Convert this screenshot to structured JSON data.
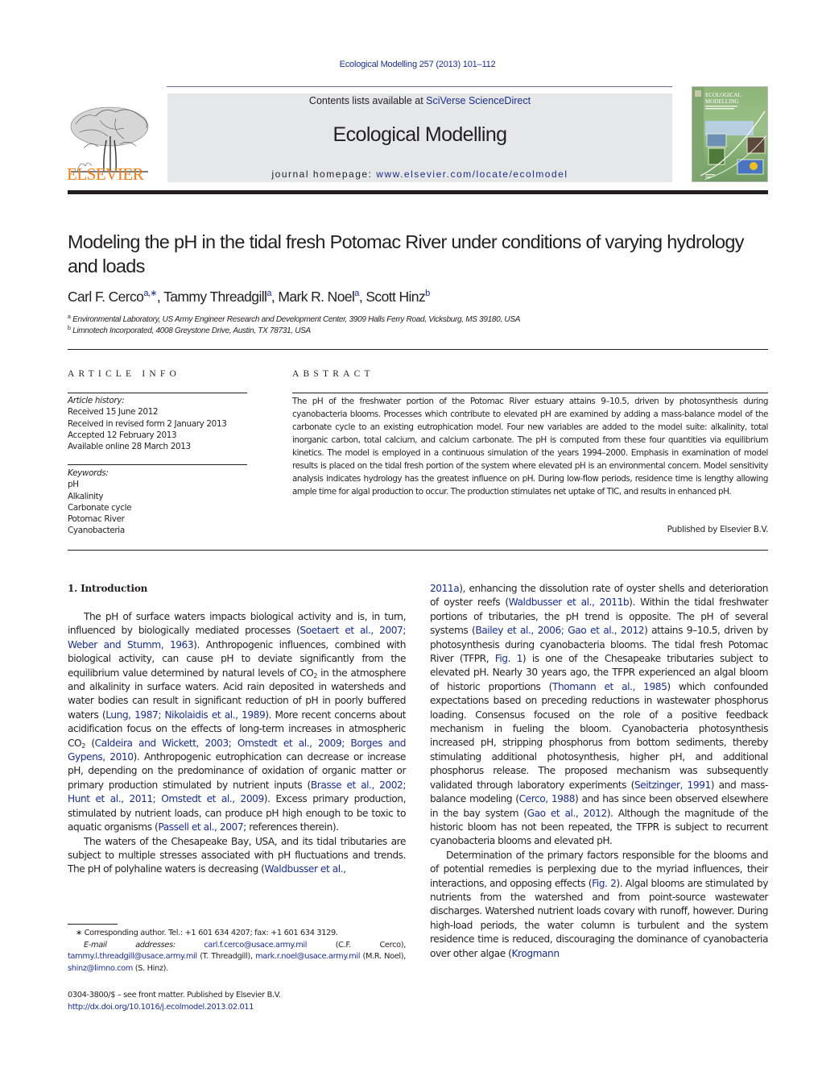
{
  "header": {
    "journal_ref": "Ecological Modelling 257 (2013) 101–112",
    "contents_prefix": "Contents lists available at ",
    "contents_link": "SciVerse ScienceDirect",
    "journal_name": "Ecological Modelling",
    "homepage_prefix": "journal homepage: ",
    "homepage_link": "www.elsevier.com/locate/ecolmodel",
    "publisher_logo": "ELSEVIER",
    "cover": {
      "line1": "ECOLOGICAL",
      "line2": "MODELLING"
    },
    "colors": {
      "link": "#1b2f8a",
      "elsevier_orange": "#f07d1a",
      "masthead_bg": "#e6e7e8"
    }
  },
  "article": {
    "title": "Modeling the pH in the tidal fresh Potomac River under conditions of varying hydrology and loads",
    "authors": [
      {
        "name": "Carl F. Cerco",
        "marks": "a,∗",
        "sep": ", "
      },
      {
        "name": "Tammy Threadgill",
        "marks": "a",
        "sep": ", "
      },
      {
        "name": "Mark R. Noel",
        "marks": "a",
        "sep": ", "
      },
      {
        "name": "Scott Hinz",
        "marks": "b",
        "sep": ""
      }
    ],
    "affiliations": [
      {
        "mark": "a",
        "text": "Environmental Laboratory, US Army Engineer Research and Development Center, 3909 Halls Ferry Road, Vicksburg, MS 39180, USA"
      },
      {
        "mark": "b",
        "text": "Limnotech Incorporated, 4008 Greystone Drive, Austin, TX 78731, USA"
      }
    ]
  },
  "article_info": {
    "heading": "ARTICLE INFO",
    "history_label": "Article history:",
    "history": [
      "Received 15 June 2012",
      "Received in revised form 2 January 2013",
      "Accepted 12 February 2013",
      "Available online 28 March 2013"
    ],
    "keywords_label": "Keywords:",
    "keywords": [
      "pH",
      "Alkalinity",
      "Carbonate cycle",
      "Potomac River",
      "Cyanobacteria"
    ]
  },
  "abstract": {
    "heading": "ABSTRACT",
    "text": "The pH of the freshwater portion of the Potomac River estuary attains 9–10.5, driven by photosynthesis during cyanobacteria blooms. Processes which contribute to elevated pH are examined by adding a mass-balance model of the carbonate cycle to an existing eutrophication model. Four new variables are added to the model suite: alkalinity, total inorganic carbon, total calcium, and calcium carbonate. The pH is computed from these four quantities via equilibrium kinetics. The model is employed in a continuous simulation of the years 1994–2000. Emphasis in examination of model results is placed on the tidal fresh portion of the system where elevated pH is an environmental concern. Model sensitivity analysis indicates hydrology has the greatest influence on pH. During low-flow periods, residence time is lengthy allowing ample time for algal production to occur. The production stimulates net uptake of TIC, and results in enhanced pH.",
    "published_by": "Published by Elsevier B.V."
  },
  "introduction": {
    "heading": "1.  Introduction",
    "left_column": [
      [
        {
          "t": "The pH of surface waters impacts biological activity and is, in turn, influenced by biologically mediated processes ("
        },
        {
          "t": "Soetaert et al., 2007; Weber and Stumm, 1963",
          "link": true
        },
        {
          "t": "). Anthropogenic influences, combined with biological activity, can cause pH to deviate significantly from the equilibrium value determined by natural levels of CO"
        },
        {
          "t": "2",
          "sub": true
        },
        {
          "t": " in the atmosphere and alkalinity in surface waters. Acid rain deposited in watersheds and water bodies can result in significant reduction of pH in poorly buffered waters ("
        },
        {
          "t": "Lung, 1987; Nikolaidis et al., 1989",
          "link": true
        },
        {
          "t": "). More recent concerns about acidification focus on the effects of long-term increases in atmospheric CO"
        },
        {
          "t": "2",
          "sub": true
        },
        {
          "t": " ("
        },
        {
          "t": "Caldeira and Wickett, 2003; Omstedt et al., 2009; Borges and Gypens, 2010",
          "link": true
        },
        {
          "t": "). Anthropogenic eutrophication can decrease or increase pH, depending on the predominance of oxidation of organic matter or primary production stimulated by nutrient inputs ("
        },
        {
          "t": "Brasse et al., 2002; Hunt et al., 2011; Omstedt et al., 2009",
          "link": true
        },
        {
          "t": "). Excess primary production, stimulated by nutrient loads, can produce pH high enough to be toxic to aquatic organisms ("
        },
        {
          "t": "Passell et al., 2007",
          "link": true
        },
        {
          "t": "; references therein)."
        }
      ],
      [
        {
          "t": "The waters of the Chesapeake Bay, USA, and its tidal tributaries are subject to multiple stresses associated with pH fluctuations and trends. The pH of polyhaline waters is decreasing ("
        },
        {
          "t": "Waldbusser et al.,",
          "link": true
        }
      ]
    ],
    "right_column": [
      [
        {
          "t": "2011a",
          "link": true
        },
        {
          "t": "), enhancing the dissolution rate of oyster shells and deterioration of oyster reefs ("
        },
        {
          "t": "Waldbusser et al., 2011b",
          "link": true
        },
        {
          "t": "). Within the tidal freshwater portions of tributaries, the pH trend is opposite. The pH of several systems ("
        },
        {
          "t": "Bailey et al., 2006; Gao et al., 2012",
          "link": true
        },
        {
          "t": ") attains 9–10.5, driven by photosynthesis during cyanobacteria blooms. The tidal fresh Potomac River (TFPR, "
        },
        {
          "t": "Fig. 1",
          "link": true
        },
        {
          "t": ") is one of the Chesapeake tributaries subject to elevated pH. Nearly 30 years ago, the TFPR experienced an algal bloom of historic proportions ("
        },
        {
          "t": "Thomann et al., 1985",
          "link": true
        },
        {
          "t": ") which confounded expectations based on preceding reductions in wastewater phosphorus loading. Consensus focused on the role of a positive feedback mechanism in fueling the bloom. Cyanobacteria photosynthesis increased pH, stripping phosphorus from bottom sediments, thereby stimulating additional photosynthesis, higher pH, and additional phosphorus release. The proposed mechanism was subsequently validated through laboratory experiments ("
        },
        {
          "t": "Seitzinger, 1991",
          "link": true
        },
        {
          "t": ") and mass-balance modeling ("
        },
        {
          "t": "Cerco, 1988",
          "link": true
        },
        {
          "t": ") and has since been observed elsewhere in the bay system ("
        },
        {
          "t": "Gao et al., 2012",
          "link": true
        },
        {
          "t": "). Although the magnitude of the historic bloom has not been repeated, the TFPR is subject to recurrent cyanobacteria blooms and elevated pH."
        }
      ],
      [
        {
          "t": "Determination of the primary factors responsible for the blooms and of potential remedies is perplexing due to the myriad influences, their interactions, and opposing effects ("
        },
        {
          "t": "Fig. 2",
          "link": true
        },
        {
          "t": "). Algal blooms are stimulated by nutrients from the watershed and from point-source wastewater discharges. Watershed nutrient loads covary with runoff, however. During high-load periods, the water column is turbulent and the system residence time is reduced, discouraging the dominance of cyanobacteria over other algae ("
        },
        {
          "t": "Krogmann",
          "link": true
        }
      ]
    ]
  },
  "footnotes": {
    "corresponding": "∗ Corresponding author. Tel.: +1 601 634 4207; fax: +1 601 634 3129.",
    "email_label": "E-mail addresses:",
    "emails": [
      {
        "email": "carl.f.cerco@usace.army.mil",
        "who": "(C.F. Cerco),"
      },
      {
        "email": "tammy.l.threadgill@usace.army.mil",
        "who": "(T. Threadgill),"
      },
      {
        "email": "mark.r.noel@usace.army.mil",
        "who": "(M.R. Noel),"
      },
      {
        "email": "shinz@limno.com",
        "who": "(S. Hinz)."
      }
    ],
    "issn": "0304-3800/$ – see front matter. Published by Elsevier B.V.",
    "doi": "http://dx.doi.org/10.1016/j.ecolmodel.2013.02.011"
  }
}
